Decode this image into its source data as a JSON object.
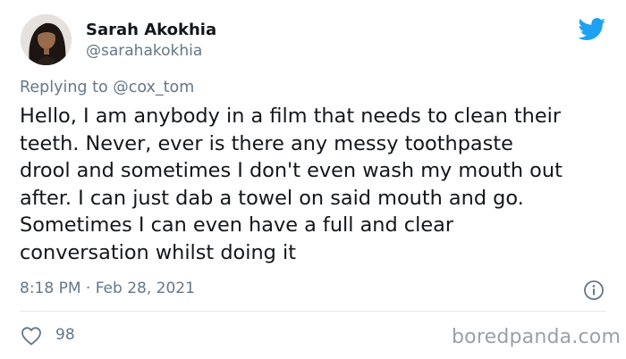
{
  "author": {
    "display_name": "Sarah Akokhia",
    "handle": "@sarahakokhia"
  },
  "reply": {
    "prefix": "Replying to",
    "mention": "@cox_tom"
  },
  "tweet": {
    "text": "Hello, I am anybody in a film that needs to clean their\nteeth. Never, ever is there any messy toothpaste\ndrool and sometimes I don't even wash my mouth out\nafter. I can just dab a towel on said mouth and go.\nSometimes I can even have a full and clear\nconversation whilst doing it",
    "timestamp": "8:18 PM · Feb 28, 2021",
    "likes": "98"
  },
  "watermark": "boredpanda.com",
  "colors": {
    "twitter_blue": "#1da1f2",
    "secondary_text": "#657786",
    "primary_text": "#14171a"
  },
  "icons": {
    "brand": "twitter-bird-icon",
    "info": "info-icon",
    "like": "heart-icon"
  }
}
